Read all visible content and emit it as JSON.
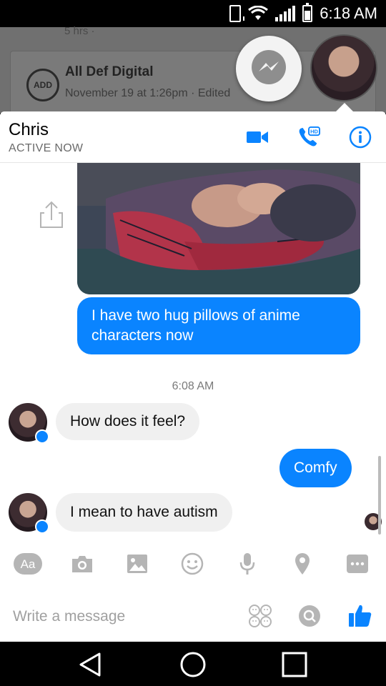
{
  "status_bar": {
    "time": "6:18 AM"
  },
  "background_post": {
    "meta": "5 hrs ·",
    "logo_text": "ADD",
    "page_name": "All Def Digital",
    "post_meta": "November 19 at 1:26pm · Edited"
  },
  "chat_header": {
    "contact_name": "Chris",
    "status": "ACTIVE NOW",
    "video_icon": "video-camera-icon",
    "call_icon": "hd-phone-icon",
    "call_label": "HD",
    "info_icon": "info-icon"
  },
  "messages": [
    {
      "side": "out",
      "text": "I have two hug pillows of anime characters now"
    },
    {
      "side": "in",
      "text": "How does it feel?"
    },
    {
      "side": "out",
      "text": "Comfy"
    },
    {
      "side": "in",
      "text": "I mean to have autism"
    }
  ],
  "timestamp": "6:08 AM",
  "toolbar": {
    "text_format_label": "Aa",
    "items": [
      "text-format-icon",
      "camera-icon",
      "image-icon",
      "emoji-icon",
      "microphone-icon",
      "location-icon",
      "more-icon"
    ]
  },
  "composer": {
    "placeholder": "Write a message",
    "stickers_icon": "stickers-icon",
    "search_icon": "search-icon",
    "like_icon": "thumbs-up-icon"
  },
  "colors": {
    "accent": "#0a84ff",
    "incoming_bubble": "#f0f0f0",
    "dim_background": "#707070"
  },
  "nav": [
    "back-icon",
    "home-icon",
    "recents-icon"
  ]
}
